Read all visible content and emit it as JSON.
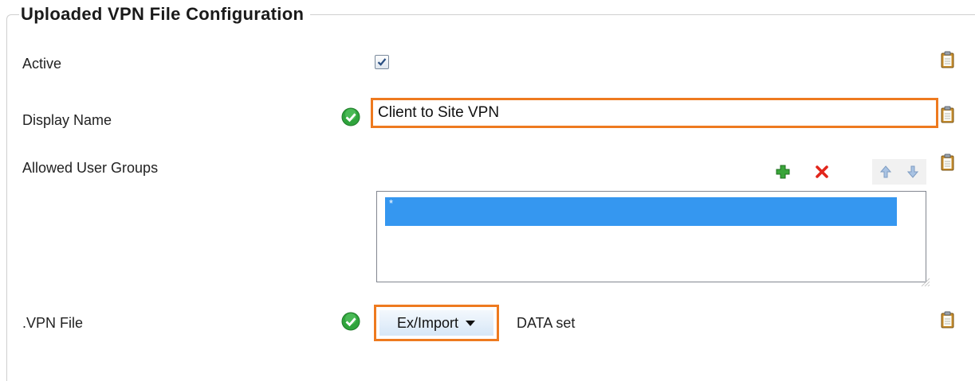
{
  "section": {
    "title": "Uploaded VPN File Configuration"
  },
  "fields": {
    "active": {
      "label": "Active",
      "checked": true
    },
    "display_name": {
      "label": "Display Name",
      "value": "Client to Site VPN"
    },
    "allowed_user_groups": {
      "label": "Allowed User Groups",
      "items": [
        "*"
      ],
      "toolbar": {
        "add_icon": "plus-icon",
        "remove_icon": "delete-icon",
        "up_icon": "arrow-up-icon",
        "down_icon": "arrow-down-icon"
      }
    },
    "vpn_file": {
      "label": ".VPN File",
      "button_label": "Ex/Import",
      "status": "DATA set"
    }
  },
  "colors": {
    "highlight": "#ee7a1f",
    "selection": "#3597f0",
    "valid": "#2fa43c",
    "remove": "#e2261c",
    "add": "#3aa53a"
  }
}
